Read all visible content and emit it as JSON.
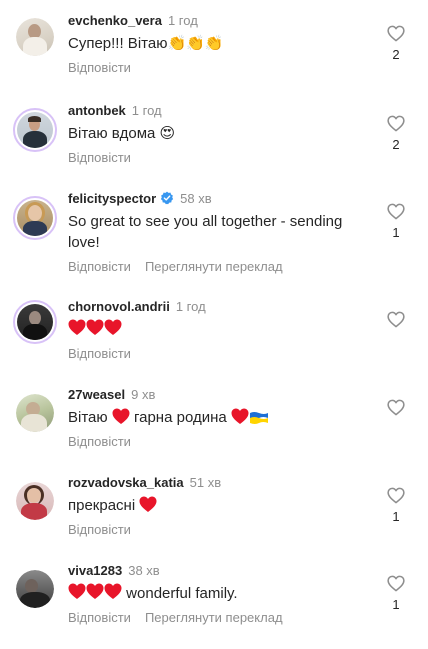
{
  "comments": [
    {
      "username": "evchenko_vera",
      "time": "1 год",
      "text": "Супер!!! Вітаю",
      "emoji": "👏👏👏",
      "reply": "Відповісти",
      "likes": "2"
    },
    {
      "username": "antonbek",
      "time": "1 год",
      "text": "Вітаю вдома",
      "emoji": "😍",
      "reply": "Відповісти",
      "likes": "2"
    },
    {
      "username": "felicityspector",
      "time": "58 хв",
      "text_line1": "So great to see you all together - sending",
      "text_line2": "love!",
      "reply": "Відповісти",
      "translate": "Переглянути переклад",
      "likes": "1"
    },
    {
      "username": "chornovol.andrii",
      "time": "1 год",
      "reply": "Відповісти"
    },
    {
      "username": "27weasel",
      "time": "9 хв",
      "text_a": "Вітаю",
      "text_b": "гарна родина",
      "reply": "Відповісти"
    },
    {
      "username": "rozvadovska_katia",
      "time": "51 хв",
      "text": "прекрасні",
      "reply": "Відповісти",
      "likes": "1"
    },
    {
      "username": "viva1283",
      "time": "38 хв",
      "text": "wonderful family.",
      "reply": "Відповісти",
      "translate": "Переглянути переклад",
      "likes": "1"
    }
  ],
  "icons": {
    "like": "heart-outline-icon",
    "verified": "verified-badge-icon",
    "heart_emoji": "red-heart-emoji",
    "flag_emoji": "ukraine-flag-emoji"
  },
  "colors": {
    "username": "#262626",
    "secondary": "#8e8e8e",
    "verified": "#3897f0",
    "heart": "#e8152a",
    "story_ring": "#d8c2f7"
  }
}
